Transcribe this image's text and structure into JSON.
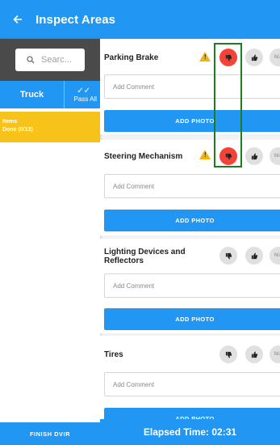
{
  "appbar": {
    "title": "Inspect Areas",
    "back_icon": "arrow-left-icon"
  },
  "sidebar": {
    "search_placeholder": "Searc...",
    "segment_truck": "Truck",
    "segment_pass_all": "Pass All",
    "items_label": "Items",
    "items_progress": "Done (0/13)",
    "finish_label": "FINISH DVIR"
  },
  "items": [
    {
      "title": "Parking Brake",
      "warning": true,
      "status": "fail",
      "comment_placeholder": "Add Comment",
      "photo_label": "ADD PHOTO"
    },
    {
      "title": "Steering Mechanism",
      "warning": true,
      "status": "fail",
      "comment_placeholder": "Add Comment",
      "photo_label": "ADD PHOTO"
    },
    {
      "title": "Lighting Devices and Reflectors",
      "warning": false,
      "status": "none",
      "comment_placeholder": "Add Comment",
      "photo_label": "ADD PHOTO"
    },
    {
      "title": "Tires",
      "warning": false,
      "status": "none",
      "comment_placeholder": "Add Comment",
      "photo_label": "ADD PHOTO"
    }
  ],
  "na_label": "N/A",
  "footer": {
    "elapsed": "Elapsed Time:  02:31"
  },
  "colors": {
    "primary": "#2196f3",
    "fail": "#f44336",
    "warning": "#f2b40c",
    "items_bg": "#f7c21a",
    "highlight": "#1e7b1e"
  }
}
